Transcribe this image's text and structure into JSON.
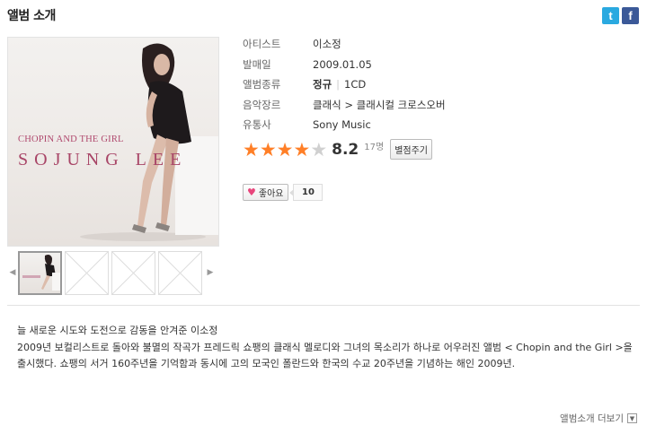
{
  "section_title": "앨범 소개",
  "share": {
    "twitter_icon": "twitter-icon",
    "facebook_icon": "facebook-icon"
  },
  "cover": {
    "line1": "CHOPIN AND THE GIRL",
    "line2": "SOJUNG  LEE"
  },
  "info": [
    {
      "label": "아티스트",
      "value": "이소정"
    },
    {
      "label": "발매일",
      "value": "2009.01.05"
    },
    {
      "label": "앨범종류",
      "value": "정규",
      "value2": "1CD"
    },
    {
      "label": "음악장르",
      "value": "클래식 > 클래시컬 크로스오버"
    },
    {
      "label": "유통사",
      "value": "Sony Music"
    }
  ],
  "rating": {
    "stars": 4,
    "max": 5,
    "score": "8.2",
    "count": "17명",
    "button": "별점주기"
  },
  "like": {
    "label": "좋아요",
    "count": "10"
  },
  "description": {
    "line1": "늘 새로운 시도와 도전으로 감동을 안겨준 이소정",
    "line2": "2009년 보컬리스트로 돌아와 불멸의 작곡가 프레드릭 쇼팽의 클래식 멜로디와 그녀의 목소리가 하나로 어우러진 앨범 < Chopin and the Girl >을 출시했다. 쇼팽의 서거 160주년을 기억함과 동시에 고의 모국인 폴란드와 한국의 수교 20주년을 기념하는 해인 2009년."
  },
  "more": {
    "label": "앨범소개 더보기"
  },
  "colors": {
    "star": "#ff7f27",
    "accent": "#b0496e"
  }
}
